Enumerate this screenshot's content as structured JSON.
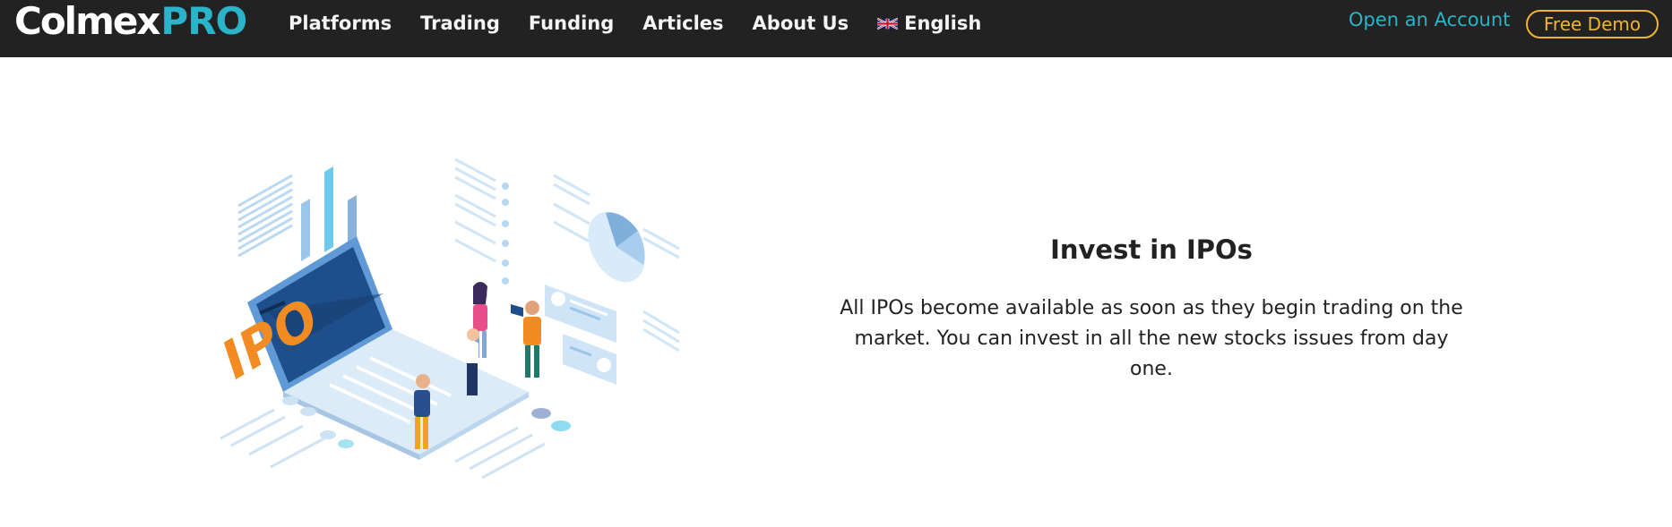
{
  "header": {
    "logo": {
      "main": "Colmex",
      "accent": "PRO"
    },
    "nav": {
      "items": [
        {
          "label": "Platforms"
        },
        {
          "label": "Trading"
        },
        {
          "label": "Funding"
        },
        {
          "label": "Articles"
        },
        {
          "label": "About Us"
        }
      ],
      "language": {
        "label": "English",
        "flag_icon": "uk-flag-icon"
      }
    },
    "open_account_label": "Open an Account",
    "free_demo_label": "Free Demo"
  },
  "hero": {
    "illustration_label": "IPO",
    "title": "Invest in IPOs",
    "body": "All IPOs become available as soon as they begin trading on the market. You can invest in all the new stocks issues from day one."
  },
  "colors": {
    "topbar_bg": "#222222",
    "accent_teal": "#2bb3c9",
    "accent_gold": "#f1b532",
    "ipo_orange": "#f28c22",
    "illustration_blue": "#1e4f8a"
  }
}
